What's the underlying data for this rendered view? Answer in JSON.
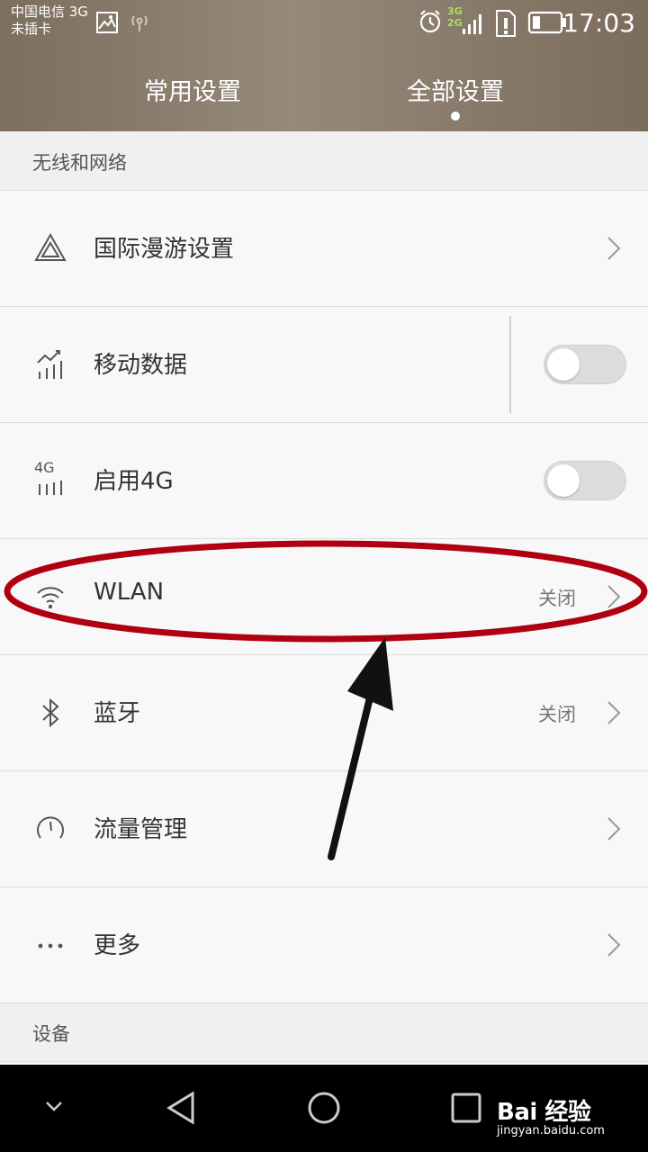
{
  "status_bar": {
    "carrier_line1": "中国电信 3G",
    "carrier_line2": "未插卡",
    "net_3g": "3G",
    "net_2g": "2G",
    "time": "17:03"
  },
  "tabs": [
    {
      "label": "常用设置",
      "selected": false
    },
    {
      "label": "全部设置",
      "selected": true
    }
  ],
  "sections": {
    "wireless": "无线和网络",
    "device": "设备"
  },
  "rows": {
    "roaming": {
      "label": "国际漫游设置",
      "icon": "triangle-icon"
    },
    "mobile_data": {
      "label": "移动数据",
      "icon": "mobile-data-icon",
      "toggle_on": false
    },
    "enable_4g": {
      "label": "启用4G",
      "icon": "4g-signal-icon",
      "icon_text": "4G",
      "toggle_on": false
    },
    "wlan": {
      "label": "WLAN",
      "value": "关闭",
      "icon": "wifi-icon"
    },
    "bluetooth": {
      "label": "蓝牙",
      "value": "关闭",
      "icon": "bluetooth-icon"
    },
    "traffic": {
      "label": "流量管理",
      "icon": "gauge-icon"
    },
    "more": {
      "label": "更多",
      "icon": "more-dots-icon"
    }
  },
  "annotation": {
    "color": "#b00010",
    "arrow_color": "#111111"
  },
  "watermark": {
    "logo": "Bai 经验",
    "url": "jingyan.baidu.com"
  },
  "colors": {
    "header_brown": "#8a7c6c",
    "toggle_off": "#dcdcdc"
  }
}
